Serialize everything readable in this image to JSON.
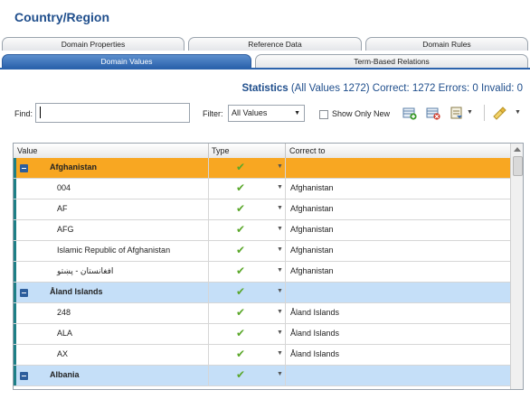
{
  "title": "Country/Region",
  "tabs_top": [
    "Domain Properties",
    "Reference Data",
    "Domain Rules"
  ],
  "tabs_bottom": [
    "Domain Values",
    "Term-Based Relations"
  ],
  "stats": {
    "heading": "Statistics",
    "all_values": "(All Values 1272)",
    "correct": "Correct: 1272",
    "errors": "Errors: 0",
    "invalid": "Invalid: 0"
  },
  "find": {
    "label": "Find:",
    "value": ""
  },
  "filter": {
    "label": "Filter:",
    "selected": "All Values"
  },
  "show_only_new": {
    "label": "Show Only New",
    "checked": false
  },
  "toolbar": {
    "icons": [
      "add-value-icon",
      "delete-value-icon",
      "import-export-icon",
      "clear-filter-icon"
    ]
  },
  "grid": {
    "columns": [
      "Value",
      "Type",
      "Correct to"
    ],
    "rows": [
      {
        "kind": "group",
        "selected": true,
        "value": "Afghanistan",
        "correct_to": ""
      },
      {
        "kind": "item",
        "value": "004",
        "correct_to": "Afghanistan"
      },
      {
        "kind": "item",
        "value": "AF",
        "correct_to": "Afghanistan"
      },
      {
        "kind": "item",
        "value": "AFG",
        "correct_to": "Afghanistan"
      },
      {
        "kind": "item",
        "value": "Islamic Republic of Afghanistan",
        "correct_to": "Afghanistan"
      },
      {
        "kind": "item",
        "value": "افغانستان - پښتو",
        "correct_to": "Afghanistan"
      },
      {
        "kind": "group",
        "selected": false,
        "value": "Åland Islands",
        "correct_to": ""
      },
      {
        "kind": "item",
        "value": "248",
        "correct_to": "Åland Islands"
      },
      {
        "kind": "item",
        "value": "ALA",
        "correct_to": "Åland Islands"
      },
      {
        "kind": "item",
        "value": "AX",
        "correct_to": "Åland Islands"
      },
      {
        "kind": "group",
        "selected": false,
        "value": "Albania",
        "correct_to": ""
      }
    ]
  },
  "colors": {
    "accent": "#2c63ac",
    "group_row": "#c5dff8",
    "selected_row": "#f8a722",
    "valid_check": "#5aa72a"
  }
}
